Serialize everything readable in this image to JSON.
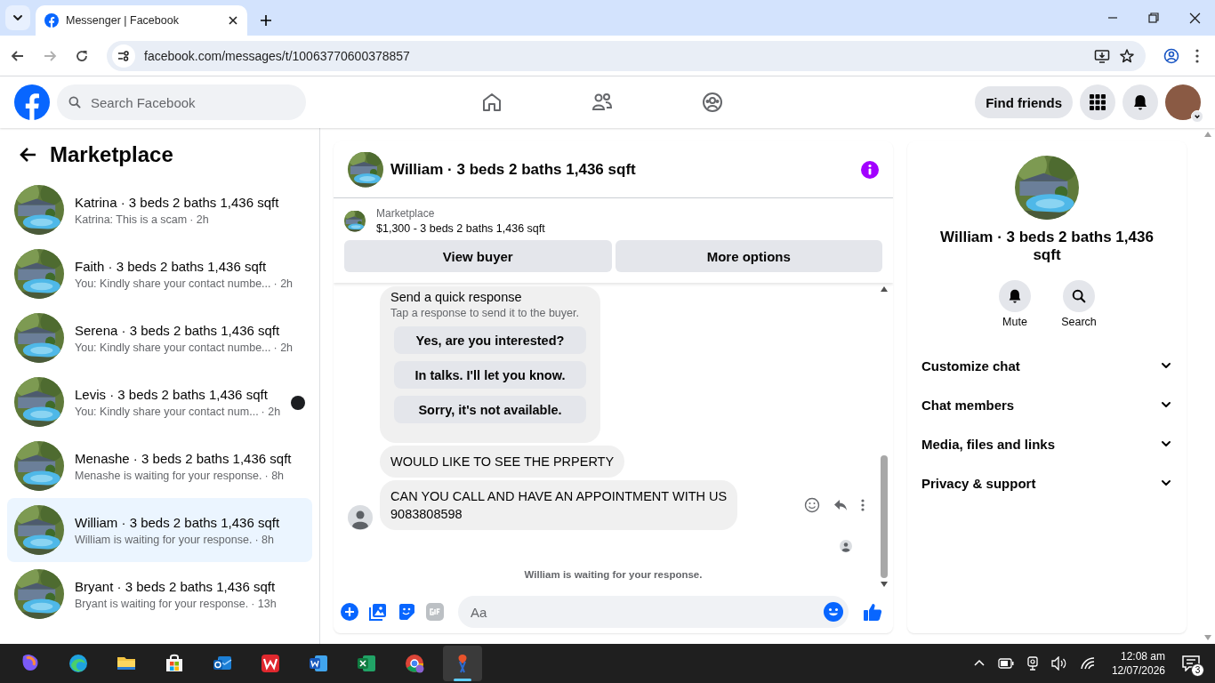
{
  "browser": {
    "tab_title": "Messenger | Facebook",
    "url": "facebook.com/messages/t/10063770600378857"
  },
  "header": {
    "search_placeholder": "Search Facebook",
    "find_friends": "Find friends"
  },
  "sidebar": {
    "title": "Marketplace",
    "conversations": [
      {
        "name": "Katrina · 3 beds 2 baths 1,436 sqft",
        "preview": "Katrina: This is a scam",
        "time": "· 2h",
        "selected": false,
        "seen": false
      },
      {
        "name": "Faith · 3 beds 2 baths 1,436 sqft",
        "preview": "You: Kindly share your contact numbe...",
        "time": "· 2h",
        "selected": false,
        "seen": false
      },
      {
        "name": "Serena · 3 beds 2 baths 1,436 sqft",
        "preview": "You: Kindly share your contact numbe...",
        "time": "· 2h",
        "selected": false,
        "seen": false
      },
      {
        "name": "Levis · 3 beds 2 baths 1,436 sqft",
        "preview": "You: Kindly share your contact num...",
        "time": "· 2h",
        "selected": false,
        "seen": true
      },
      {
        "name": "Menashe · 3 beds 2 baths 1,436 sqft",
        "preview": "Menashe is waiting for your response.",
        "time": "· 8h",
        "selected": false,
        "seen": false
      },
      {
        "name": "William · 3 beds 2 baths 1,436 sqft",
        "preview": "William is waiting for your response.",
        "time": "· 8h",
        "selected": true,
        "seen": false
      },
      {
        "name": "Bryant · 3 beds 2 baths 1,436 sqft",
        "preview": "Bryant is waiting for your response.",
        "time": "· 13h",
        "selected": false,
        "seen": false
      }
    ]
  },
  "chat": {
    "title": "William · 3 beds 2 baths 1,436 sqft",
    "listing": {
      "label": "Marketplace",
      "summary": "$1,300 - 3 beds 2 baths 1,436 sqft"
    },
    "actions": [
      "View buyer",
      "More options"
    ],
    "quick_response": {
      "title": "Send a quick response",
      "hint": "Tap a response to send it to the buyer.",
      "options": [
        "Yes, are you interested?",
        "In talks. I'll let you know.",
        "Sorry, it's not available."
      ]
    },
    "messages": [
      {
        "text": "WOULD LIKE TO SEE THE PRPERTY",
        "avatar": false
      },
      {
        "text": "CAN YOU CALL AND HAVE AN APPOINTMENT WITH US\n9083808598",
        "avatar": true
      }
    ],
    "status": "William is waiting for your response.",
    "composer_placeholder": "Aa"
  },
  "info": {
    "title": "William · 3 beds 2 baths 1,436 sqft",
    "actions": [
      {
        "kind": "mute",
        "label": "Mute"
      },
      {
        "kind": "search",
        "label": "Search"
      }
    ],
    "sections": [
      "Customize chat",
      "Chat members",
      "Media, files and links",
      "Privacy & support"
    ]
  },
  "taskbar": {
    "time": "12:08 am",
    "date": "12/07/2026",
    "notifications": "3"
  }
}
